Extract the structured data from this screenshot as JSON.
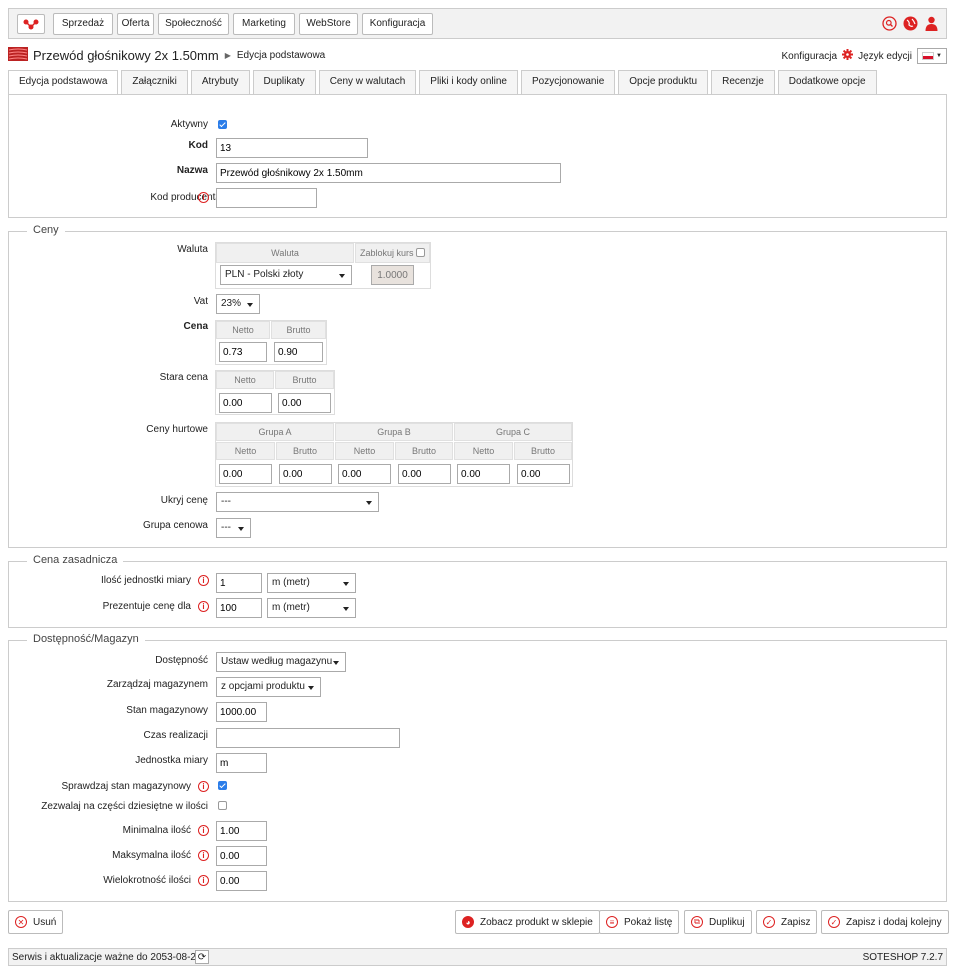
{
  "nav": {
    "items": [
      "Sprzedaż",
      "Oferta",
      "Społeczność",
      "Marketing",
      "WebStore",
      "Konfiguracja"
    ]
  },
  "breadcrumb": {
    "title": "Przewód głośnikowy 2x 1.50mm",
    "sub": "Edycja podstawowa"
  },
  "config": {
    "label": "Konfiguracja",
    "lang_label": "Język edycji"
  },
  "tabs": [
    "Edycja podstawowa",
    "Załączniki",
    "Atrybuty",
    "Duplikaty",
    "Ceny w walutach",
    "Pliki i kody online",
    "Pozycjonowanie",
    "Opcje produktu",
    "Recenzje",
    "Dodatkowe opcje"
  ],
  "basic": {
    "aktywny_label": "Aktywny",
    "aktywny": true,
    "kod_label": "Kod",
    "kod": "13",
    "nazwa_label": "Nazwa",
    "nazwa": "Przewód głośnikowy 2x 1.50mm",
    "kodprod_label": "Kod producenta",
    "kodprod": ""
  },
  "ceny": {
    "legend": "Ceny",
    "waluta_label": "Waluta",
    "waluta_head": "Waluta",
    "zablokuj_head": "Zablokuj kurs",
    "waluta": "PLN - Polski złoty",
    "kurs": "1.0000",
    "vat_label": "Vat",
    "vat": "23%",
    "cena_label": "Cena",
    "netto_head": "Netto",
    "brutto_head": "Brutto",
    "cena_netto": "0.73",
    "cena_brutto": "0.90",
    "stara_label": "Stara cena",
    "stara_netto": "0.00",
    "stara_brutto": "0.00",
    "hurt_label": "Ceny hurtowe",
    "groups": [
      "Grupa A",
      "Grupa B",
      "Grupa C"
    ],
    "hurt_values": [
      "0.00",
      "0.00",
      "0.00",
      "0.00",
      "0.00",
      "0.00"
    ],
    "ukryj_label": "Ukryj cenę",
    "ukryj": "---",
    "grupa_label": "Grupa cenowa",
    "grupa": "---"
  },
  "zasad": {
    "legend": "Cena zasadnicza",
    "ilosc_label": "Ilość jednostki miary",
    "ilosc": "1",
    "ilosc_unit": "m (metr)",
    "prez_label": "Prezentuje cenę dla",
    "prez": "100",
    "prez_unit": "m (metr)"
  },
  "mag": {
    "legend": "Dostępność/Magazyn",
    "dost_label": "Dostępność",
    "dost": "Ustaw według magazynu",
    "zarz_label": "Zarządzaj magazynem",
    "zarz": "z opcjami produktu",
    "stan_label": "Stan magazynowy",
    "stan": "1000.00",
    "czas_label": "Czas realizacji",
    "czas": "",
    "jedn_label": "Jednostka miary",
    "jedn": "m",
    "spr_label": "Sprawdzaj stan magazynowy",
    "spr": true,
    "dzies_label": "Zezwalaj na części dziesiętne w ilości",
    "dzies": false,
    "min_label": "Minimalna ilość",
    "min": "1.00",
    "max_label": "Maksymalna ilość",
    "max": "0.00",
    "wiel_label": "Wielokrotność ilości",
    "wiel": "0.00"
  },
  "actions": {
    "delete": "Usuń",
    "view": "Zobacz produkt w sklepie",
    "list": "Pokaż listę",
    "dup": "Duplikuj",
    "save": "Zapisz",
    "save_add": "Zapisz i dodaj kolejny"
  },
  "footer": {
    "service": "Serwis i aktualizacje ważne do 2053-08-26",
    "version": "SOTESHOP 7.2.7"
  },
  "colors": {
    "accent": "#d22222",
    "check": "#2b7de9"
  }
}
